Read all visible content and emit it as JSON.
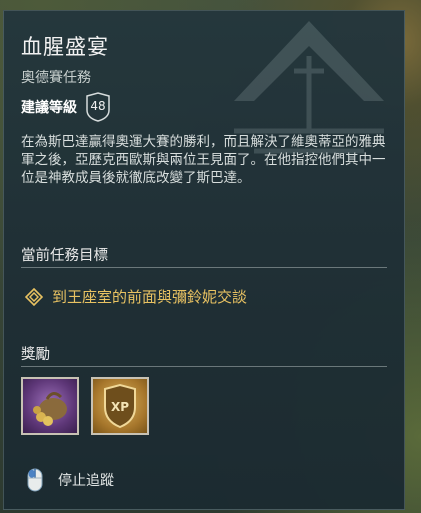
{
  "quest": {
    "title": "血腥盛宴",
    "subtitle": "奧德賽任務",
    "level_label": "建議等級",
    "level": "48",
    "description": "在為斯巴達贏得奧運大賽的勝利，而且解決了維奧蒂亞的雅典軍之後，亞歷克西歐斯與兩位王見面了。在他指控他們其中一位是神教成員後就徹底改變了斯巴達。"
  },
  "objectives": {
    "header": "當前任務目標",
    "items": [
      {
        "text": "到王座室的前面與彌鈴妮交談",
        "icon": "diamond-objective-icon"
      }
    ]
  },
  "rewards": {
    "header": "獎勵",
    "items": [
      {
        "icon": "coin-pouch-icon",
        "label": ""
      },
      {
        "icon": "xp-shield-icon",
        "label": "XP"
      }
    ]
  },
  "tracking": {
    "label": "停止追蹤",
    "icon": "mouse-icon"
  },
  "colors": {
    "objective": "#e8c262",
    "panel": "#24363c"
  }
}
